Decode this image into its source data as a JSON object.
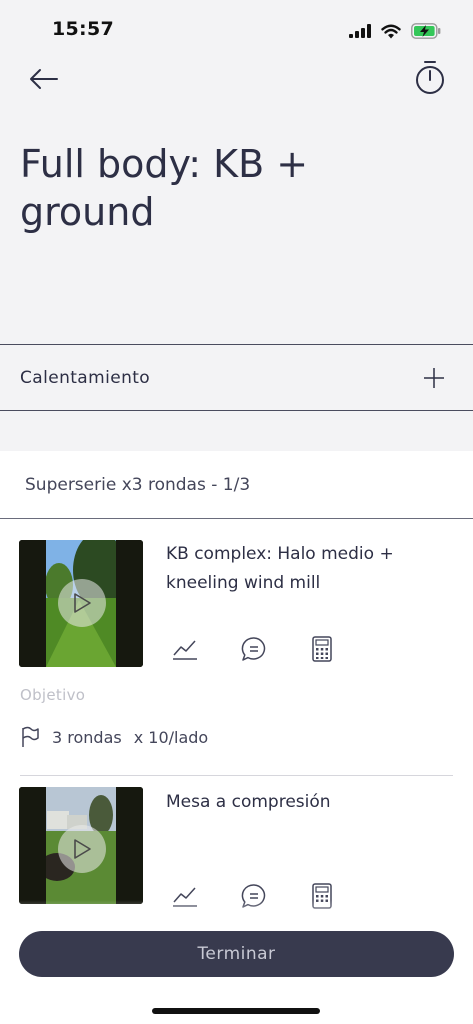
{
  "status_bar": {
    "time": "15:57"
  },
  "header": {
    "title": "Full body: KB + ground"
  },
  "warmup": {
    "label": "Calentamiento"
  },
  "superserie": {
    "label": "Superserie x3 rondas - 1/3"
  },
  "exercises": [
    {
      "name": "KB complex: Halo medio + kneeling wind mill",
      "objective_label": "Objetivo",
      "rounds": "3 rondas",
      "reps": "x 10/lado"
    },
    {
      "name": "Mesa a compresión"
    }
  ],
  "footer": {
    "finish_label": "Terminar"
  },
  "colors": {
    "primary": "#383a4e",
    "background": "#f3f3f5",
    "text": "#2d2f45"
  }
}
